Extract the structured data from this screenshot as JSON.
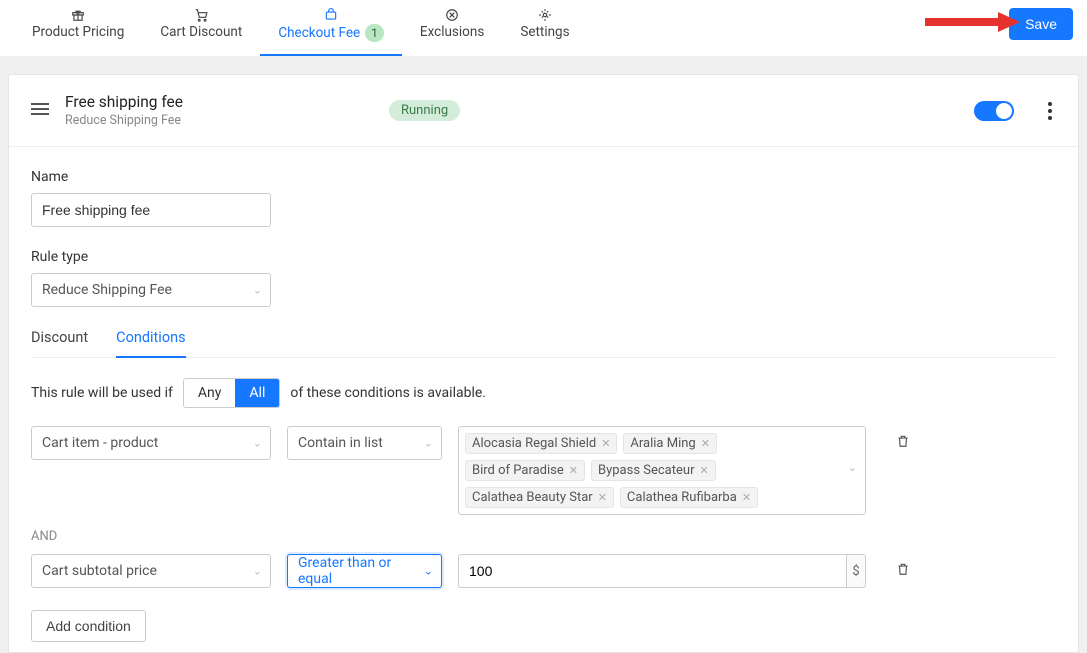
{
  "header": {
    "tabs": [
      {
        "label": "Product Pricing",
        "active": false
      },
      {
        "label": "Cart Discount",
        "active": false
      },
      {
        "label": "Checkout Fee",
        "active": true,
        "badge": "1"
      },
      {
        "label": "Exclusions",
        "active": false
      },
      {
        "label": "Settings",
        "active": false
      }
    ],
    "save_label": "Save"
  },
  "rule": {
    "title": "Free shipping fee",
    "subtitle": "Reduce Shipping Fee",
    "status": "Running",
    "enabled": true
  },
  "form": {
    "name_label": "Name",
    "name_value": "Free shipping fee",
    "ruletype_label": "Rule type",
    "ruletype_value": "Reduce Shipping Fee"
  },
  "subtabs": {
    "discount": "Discount",
    "conditions": "Conditions"
  },
  "conditions": {
    "sentence_pre": "This rule will be used if",
    "sentence_post": "of these conditions is available.",
    "any_label": "Any",
    "all_label": "All",
    "rows": [
      {
        "field": "Cart item - product",
        "operator": "Contain in list",
        "tags": [
          "Alocasia Regal Shield",
          "Aralia Ming",
          "Bird of Paradise",
          "Bypass Secateur",
          "Calathea Beauty Star",
          "Calathea Rufibarba"
        ]
      },
      {
        "joiner": "AND",
        "field": "Cart subtotal price",
        "operator": "Greater than or equal",
        "operator_focused": true,
        "value": "100",
        "suffix": "$"
      }
    ],
    "add_label": "Add condition"
  }
}
